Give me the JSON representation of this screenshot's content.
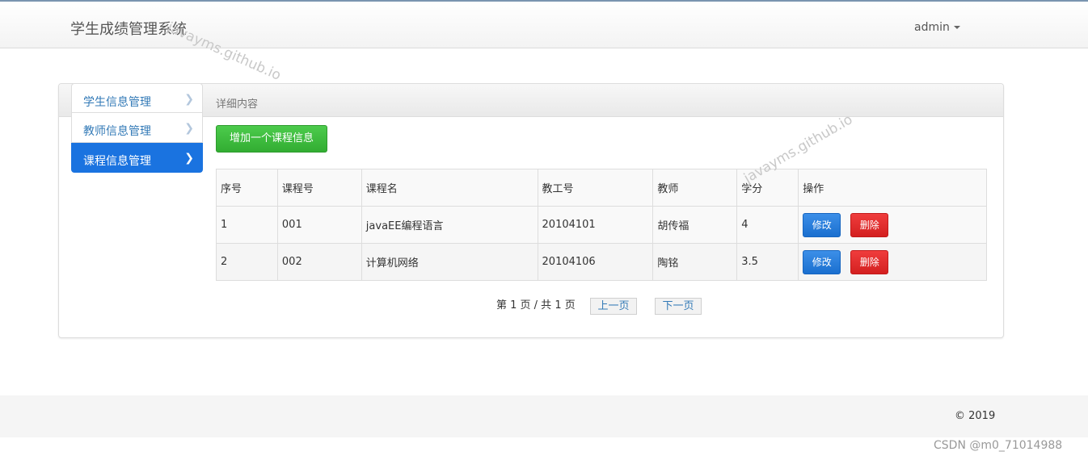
{
  "header": {
    "brand": "学生成绩管理系统",
    "user": "admin"
  },
  "watermark": "javayms.github.io",
  "sidebar": {
    "items": [
      {
        "label": "学生信息管理"
      },
      {
        "label": "教师信息管理"
      },
      {
        "label": "课程信息管理",
        "active": true
      }
    ]
  },
  "panel": {
    "title": "详细内容",
    "add_button": "增加一个课程信息"
  },
  "table": {
    "columns": [
      "序号",
      "课程号",
      "课程名",
      "教工号",
      "教师",
      "学分",
      "操作"
    ],
    "rows": [
      {
        "index": "1",
        "course_no": "001",
        "course_name": "javaEE编程语言",
        "teacher_no": "20104101",
        "teacher": "胡传福",
        "credit": "4"
      },
      {
        "index": "2",
        "course_no": "002",
        "course_name": "计算机网络",
        "teacher_no": "20104106",
        "teacher": "陶铭",
        "credit": "3.5"
      }
    ],
    "edit_label": "修改",
    "delete_label": "删除"
  },
  "pagination": {
    "info": "第 1 页 / 共 1 页",
    "prev": "上一页",
    "next": "下一页"
  },
  "footer": {
    "copyright": "© 2019"
  },
  "source_mark": "CSDN @m0_71014988",
  "colors": {
    "primary": "#1a73e0",
    "success": "#3cbc3c",
    "danger": "#e02b2b"
  }
}
